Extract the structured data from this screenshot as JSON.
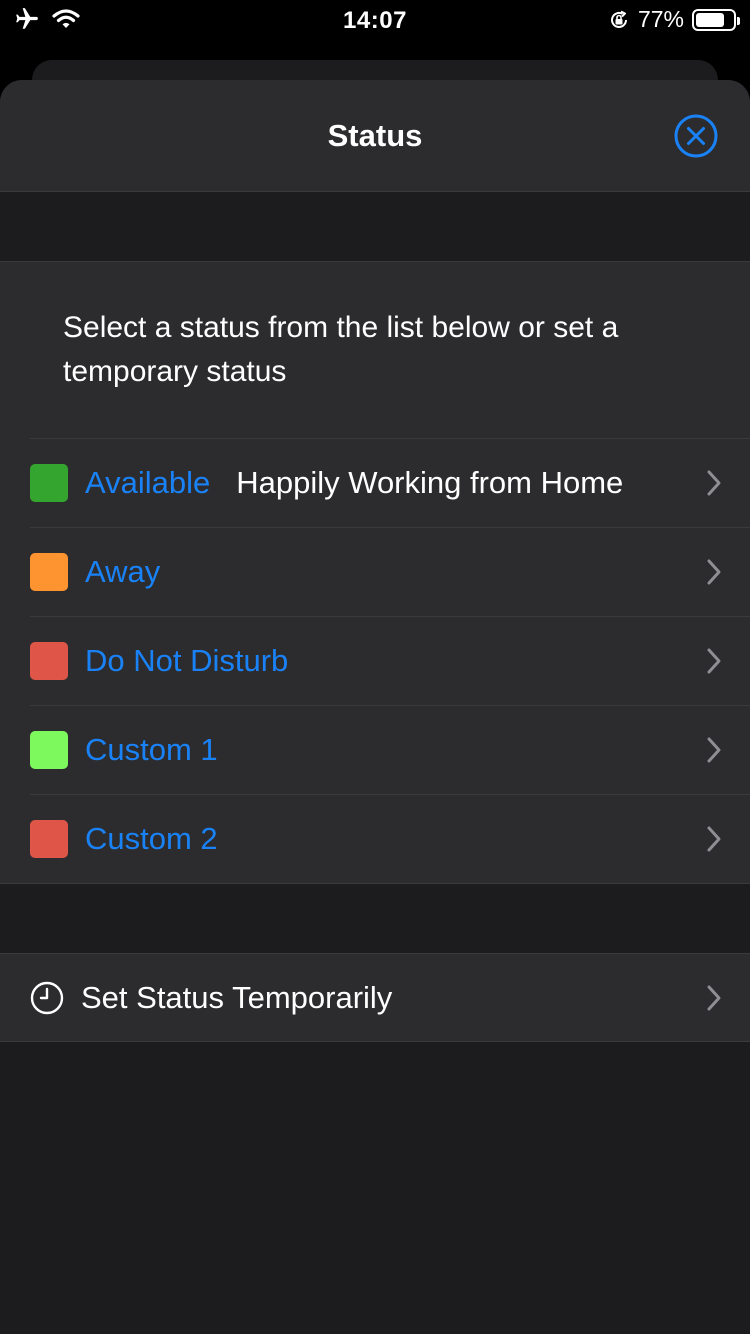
{
  "status_bar": {
    "time": "14:07",
    "battery_percent": "77%",
    "battery_level": 0.77,
    "icons": [
      "airplane-icon",
      "wifi-icon",
      "orientation-lock-icon",
      "battery-icon"
    ]
  },
  "sheet": {
    "title": "Status",
    "close_icon": "close-circle-icon",
    "description": "Select a status from the list below or set a temporary status",
    "statuses": [
      {
        "name": "Available",
        "message": "Happily Working from Home",
        "color": "#34a62f"
      },
      {
        "name": "Away",
        "message": "",
        "color": "#fd9430"
      },
      {
        "name": "Do Not Disturb",
        "message": "",
        "color": "#df5648"
      },
      {
        "name": "Custom 1",
        "message": "",
        "color": "#7ef95d"
      },
      {
        "name": "Custom 2",
        "message": "",
        "color": "#df5648"
      }
    ],
    "temporary": {
      "label": "Set Status Temporarily",
      "icon": "clock-icon"
    }
  },
  "colors": {
    "accent": "#1a82f7",
    "background": "#1c1c1e",
    "cell": "#2c2c2e",
    "separator": "#3a3a3c",
    "chevron": "#8e8e93"
  }
}
